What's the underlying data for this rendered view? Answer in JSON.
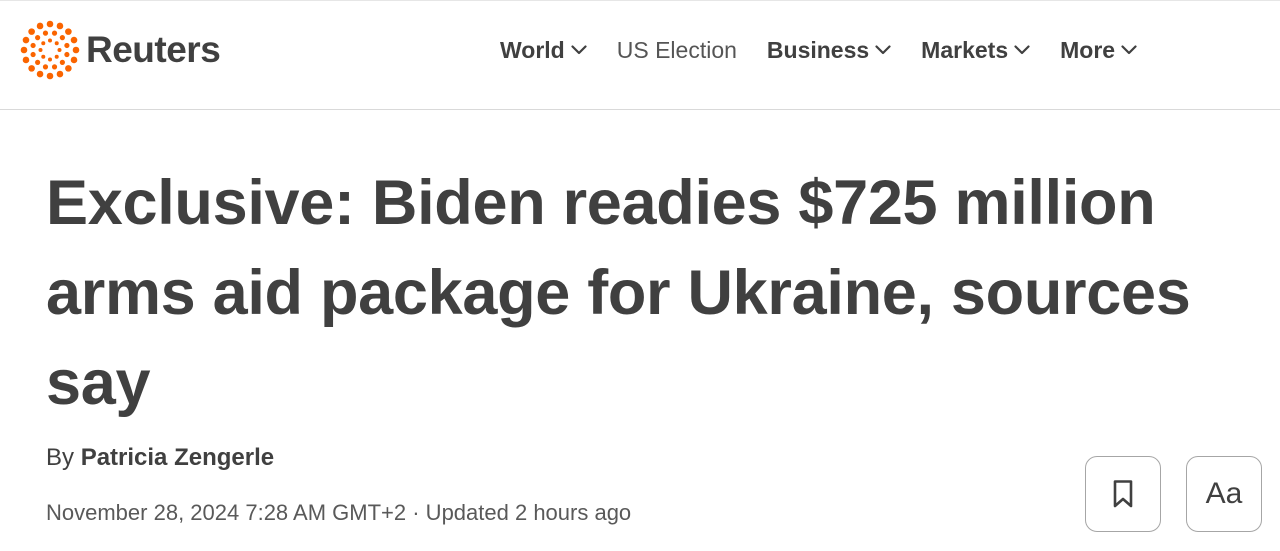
{
  "brand": {
    "name": "Reuters",
    "accent_color": "#fa6400",
    "logo_icon": "reuters-dots-logo-icon"
  },
  "nav": {
    "items": [
      {
        "label": "World",
        "dropdown": true
      },
      {
        "label": "US Election",
        "dropdown": false
      },
      {
        "label": "Business",
        "dropdown": true
      },
      {
        "label": "Markets",
        "dropdown": true
      },
      {
        "label": "More",
        "dropdown": true
      }
    ]
  },
  "article": {
    "headline": "Exclusive: Biden readies $725 million arms aid package for Ukraine, sources say",
    "byline_prefix": "By",
    "author": "Patricia Zengerle",
    "dateline": "November 28, 2024 7:28 AM GMT+2 · Updated 2 hours ago"
  },
  "actions": {
    "bookmark_icon": "bookmark-icon",
    "text_size_label": "Aa"
  }
}
